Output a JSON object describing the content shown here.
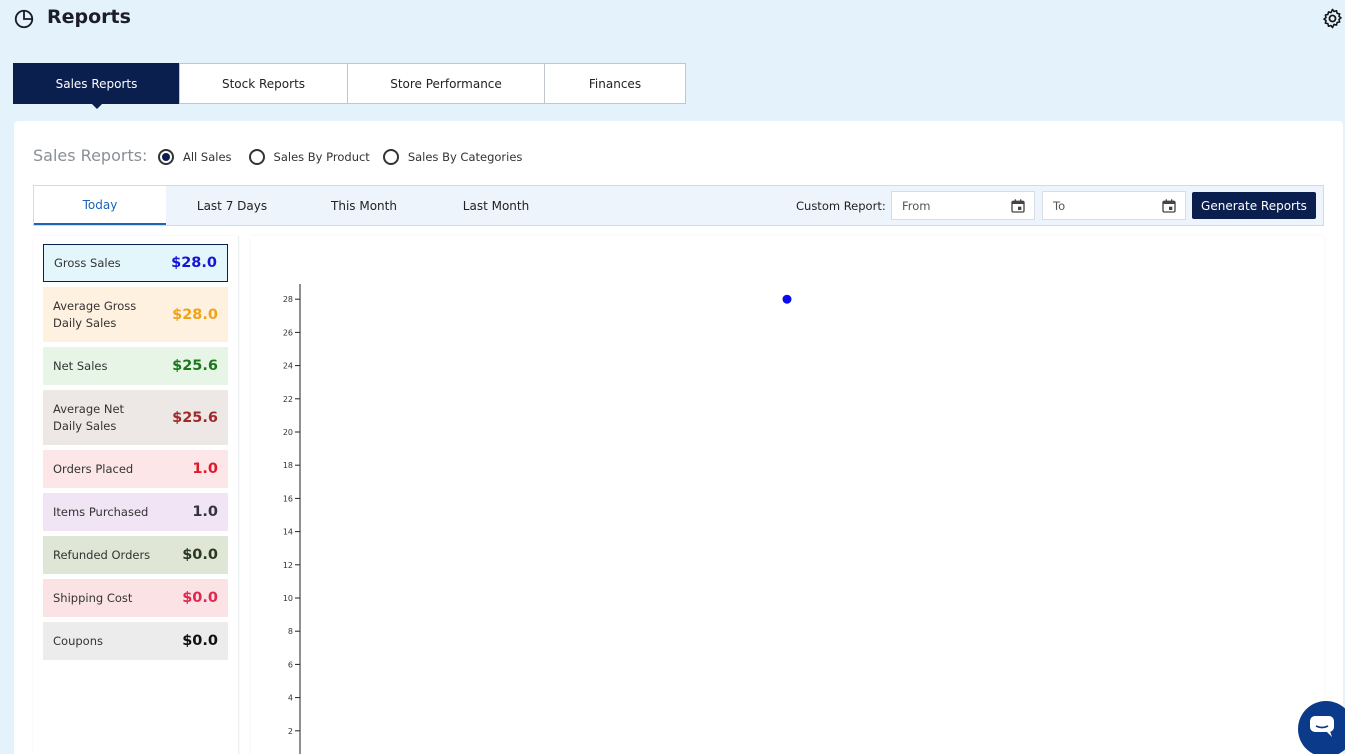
{
  "header": {
    "title": "Reports",
    "icon": "pie-chart-icon",
    "settings_icon": "gear-icon"
  },
  "tabs": [
    {
      "label": "Sales Reports",
      "active": true
    },
    {
      "label": "Stock Reports",
      "active": false
    },
    {
      "label": "Store Performance",
      "active": false
    },
    {
      "label": "Finances",
      "active": false
    }
  ],
  "sales_reports": {
    "label": "Sales Reports:",
    "options": [
      {
        "label": "All Sales",
        "checked": true
      },
      {
        "label": "Sales By Product",
        "checked": false
      },
      {
        "label": "Sales By Categories",
        "checked": false
      }
    ]
  },
  "periods": [
    {
      "label": "Today",
      "active": true
    },
    {
      "label": "Last 7 Days",
      "active": false
    },
    {
      "label": "This Month",
      "active": false
    },
    {
      "label": "Last Month",
      "active": false
    }
  ],
  "custom_report": {
    "label": "Custom Report:",
    "from_placeholder": "From",
    "to_placeholder": "To",
    "generate_label": "Generate Reports"
  },
  "stats": [
    {
      "name": "Gross Sales",
      "value": "$28.0",
      "color": "#1515d6",
      "bg": "#e3f6fb"
    },
    {
      "name": "Average Gross Daily Sales",
      "value": "$28.0",
      "color": "#f0a31a",
      "bg": "#fff1e0"
    },
    {
      "name": "Net Sales",
      "value": "$25.6",
      "color": "#1a7a1a",
      "bg": "#e6f5e6"
    },
    {
      "name": "Average Net Daily Sales",
      "value": "$25.6",
      "color": "#a02a2a",
      "bg": "#ede8e6"
    },
    {
      "name": "Orders Placed",
      "value": "1.0",
      "color": "#e01a2a",
      "bg": "#fde6e8"
    },
    {
      "name": "Items Purchased",
      "value": "1.0",
      "color": "#333344",
      "bg": "#f1e4f4"
    },
    {
      "name": "Refunded Orders",
      "value": "$0.0",
      "color": "#2a3a22",
      "bg": "#dfe6d6"
    },
    {
      "name": "Shipping Cost",
      "value": "$0.0",
      "color": "#e0274f",
      "bg": "#fbe3e5"
    },
    {
      "name": "Coupons",
      "value": "$0.0",
      "color": "#111111",
      "bg": "#ececec"
    }
  ],
  "chart_data": {
    "type": "scatter",
    "y_ticks": [
      "28",
      "26",
      "24",
      "22",
      "20",
      "18",
      "16",
      "14",
      "12",
      "10",
      "8",
      "6",
      "4",
      "2"
    ],
    "ylim": [
      0,
      28
    ],
    "points": [
      {
        "y": 28
      }
    ],
    "point_color": "#0a0af0"
  }
}
